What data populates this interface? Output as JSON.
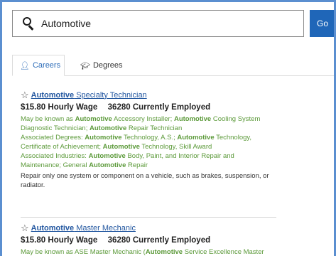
{
  "search": {
    "value": "Automotive",
    "go_label": "Go"
  },
  "tabs": [
    {
      "label": "Careers",
      "icon": "person-icon",
      "active": true
    },
    {
      "label": "Degrees",
      "icon": "graduation-cap-icon",
      "active": false
    }
  ],
  "results": [
    {
      "title_bold": "Automotive",
      "title_rest": " Specialty Technician",
      "wage": "$15.80",
      "wage_label": "Hourly Wage",
      "employed": "36280",
      "employed_label": "Currently Employed",
      "known_as": {
        "prefix": "May be known as ",
        "p1b": "Automotive",
        "p1": " Accessory Installer; ",
        "p2b": "Automotive",
        "p2": " Cooling System Diagnostic Technician; ",
        "p3b": "Automotive",
        "p3": " Repair Technician"
      },
      "degrees": {
        "prefix": "Associated Degrees: ",
        "p1b": "Automotive",
        "p1": " Technology, A.S.; ",
        "p2b": "Automotive",
        "p2": " Technology, Certificate of Achievement; ",
        "p3b": "Automotive",
        "p3": " Technology, Skill Award"
      },
      "industries": {
        "prefix": "Associated Industries: ",
        "p1b": "Automotive",
        "p1": " Body, Paint, and Interior Repair and Maintenance; General ",
        "p2b": "Automotive",
        "p2": " Repair"
      },
      "description": "Repair only one system or component on a vehicle, such as brakes, suspension, or radiator."
    },
    {
      "title_bold": "Automotive",
      "title_rest": " Master Mechanic",
      "wage": "$15.80",
      "wage_label": "Hourly Wage",
      "employed": "36280",
      "employed_label": "Currently Employed",
      "known_as": {
        "prefix": "May be known as ASE Master Mechanic (",
        "p1b": "Automotive",
        "p1": " Service Excellence Master"
      }
    }
  ],
  "colors": {
    "accent": "#1f66b8",
    "link": "#2357a0",
    "green_text": "#5c9a3a",
    "frame_border": "#5b8fd0"
  }
}
